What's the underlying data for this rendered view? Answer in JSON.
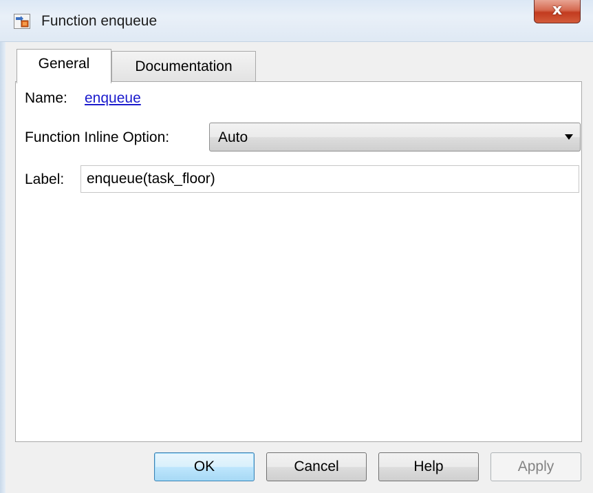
{
  "window": {
    "title": "Function enqueue",
    "close_glyph": "x"
  },
  "tabs": [
    {
      "label": "General",
      "selected": true
    },
    {
      "label": "Documentation",
      "selected": false
    }
  ],
  "general": {
    "name_label": "Name:",
    "name_value": "enqueue",
    "inline_label": "Function Inline Option:",
    "inline_value": "Auto",
    "label_label": "Label:",
    "label_value": "enqueue(task_floor)"
  },
  "buttons": {
    "ok": "OK",
    "cancel": "Cancel",
    "help": "Help",
    "apply": "Apply"
  },
  "colors": {
    "link": "#1a1acc",
    "close_button": "#c23b1f",
    "default_button_border": "#3c7fb1"
  },
  "icons": {
    "app": "simulink-block-icon",
    "close": "close-icon",
    "dropdown": "chevron-down-icon"
  }
}
